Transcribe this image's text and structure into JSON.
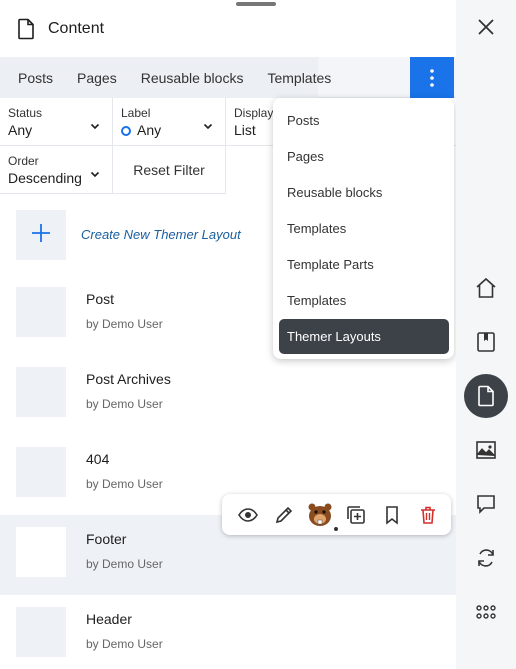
{
  "header": {
    "title": "Content"
  },
  "tabs": [
    "Posts",
    "Pages",
    "Reusable blocks",
    "Templates"
  ],
  "filters": {
    "status": {
      "label": "Status",
      "value": "Any"
    },
    "label": {
      "label": "Label",
      "value": "Any"
    },
    "display": {
      "label": "Display",
      "value": "List"
    },
    "order": {
      "label": "Order",
      "value": "Descending"
    },
    "reset_label": "Reset Filter"
  },
  "create": {
    "label": "Create New Themer Layout"
  },
  "items": [
    {
      "name": "Post",
      "author": "by Demo User"
    },
    {
      "name": "Post Archives",
      "author": "by Demo User"
    },
    {
      "name": "404",
      "author": "by Demo User"
    },
    {
      "name": "Footer",
      "author": "by Demo User"
    },
    {
      "name": "Header",
      "author": "by Demo User"
    }
  ],
  "dropdown": {
    "items": [
      "Posts",
      "Pages",
      "Reusable blocks",
      "Templates",
      "Template Parts",
      "Templates",
      "Themer Layouts"
    ],
    "selected": "Themer Layouts"
  },
  "icons": {
    "header": "document-icon",
    "actions": [
      "eye-icon",
      "pencil-icon",
      "beaver-icon",
      "duplicate-icon",
      "bookmark-icon",
      "trash-icon"
    ],
    "rail": [
      "home-icon",
      "saved-icon",
      "content-icon",
      "media-icon",
      "comment-icon",
      "sync-icon",
      "apps-icon"
    ]
  },
  "colors": {
    "accent": "#1a73e8",
    "active_dark": "#3c4248",
    "delete": "#d32f2f",
    "link": "#1a5e9e"
  }
}
